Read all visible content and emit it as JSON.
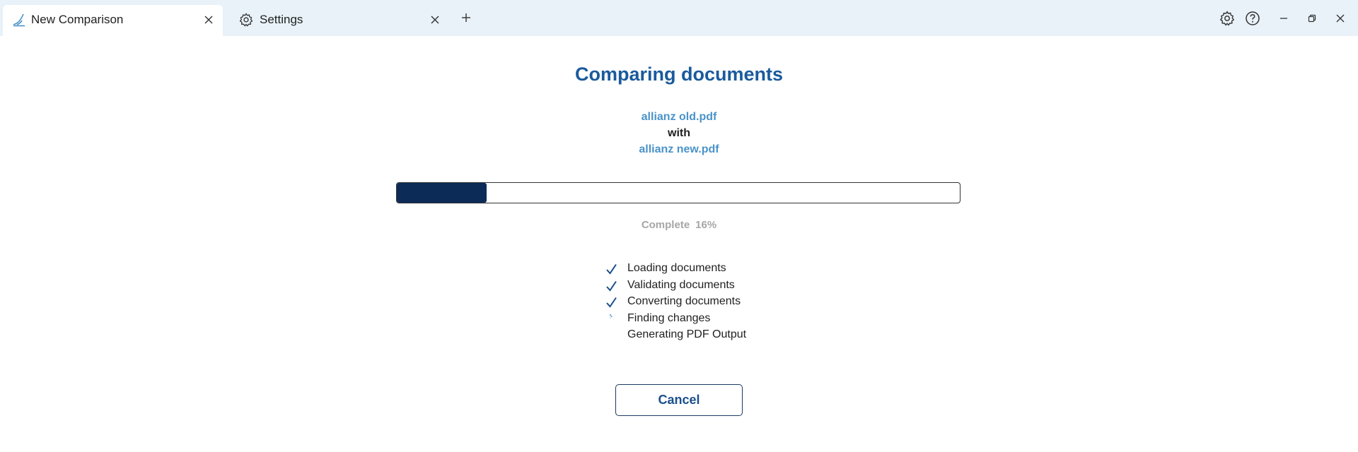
{
  "tabs": [
    {
      "label": "New Comparison",
      "icon": "compare-app-icon",
      "active": true
    },
    {
      "label": "Settings",
      "icon": "gear-icon",
      "active": false
    }
  ],
  "window_controls": [
    "gear-icon",
    "help-icon",
    "minimize-icon",
    "restore-icon",
    "close-icon"
  ],
  "main": {
    "title": "Comparing documents",
    "old_document": "allianz old.pdf",
    "with_text": "with",
    "new_document": "allianz new.pdf"
  },
  "progress": {
    "label": "Complete",
    "percent_text": "16%",
    "value": 0.16
  },
  "steps": [
    {
      "label": "Loading documents",
      "status": "done"
    },
    {
      "label": "Validating documents",
      "status": "done"
    },
    {
      "label": "Converting documents",
      "status": "done"
    },
    {
      "label": "Finding changes",
      "status": "in-progress"
    },
    {
      "label": "Generating PDF Output",
      "status": "pending"
    }
  ],
  "cancel_label": "Cancel",
  "colors": {
    "title": "#1a5a9c",
    "doc_link": "#4a93c9",
    "progress_fill": "#0d2b57",
    "titlebar_bg": "#e8f2f8"
  }
}
